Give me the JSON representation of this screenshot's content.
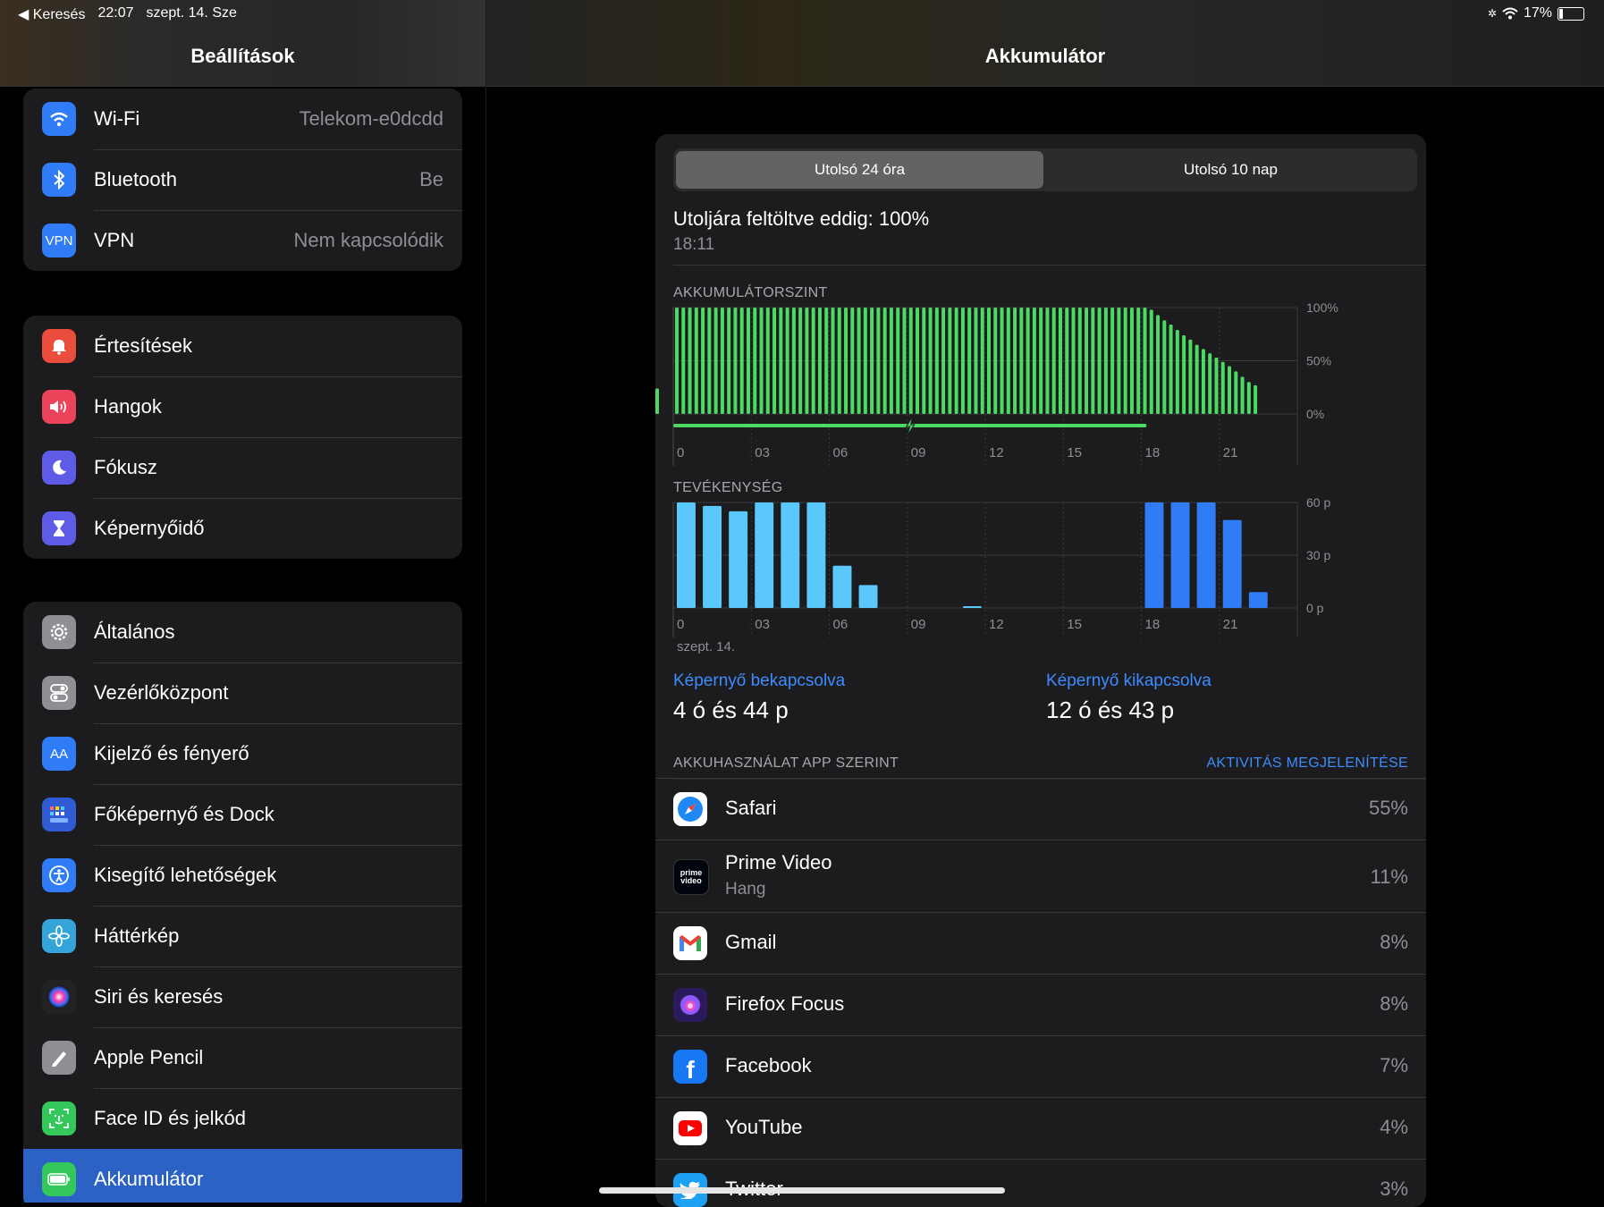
{
  "status_bar": {
    "back_label": "◀ Keresés",
    "time": "22:07",
    "date": "szept. 14. Sze",
    "battery_pct": "17%",
    "battery_level": 0.17
  },
  "sidebar": {
    "title": "Beállítások",
    "group1": [
      {
        "label": "Wi-Fi",
        "value": "Telekom-e0dcdd",
        "icon": "wifi-icon",
        "color": "#2f7cf6"
      },
      {
        "label": "Bluetooth",
        "value": "Be",
        "icon": "bluetooth-icon",
        "color": "#2f7cf6"
      },
      {
        "label": "VPN",
        "value": "Nem kapcsolódik",
        "icon": "vpn-icon",
        "icon_text": "VPN",
        "color": "#2f7cf6"
      }
    ],
    "group2": [
      {
        "label": "Értesítések",
        "icon": "notifications-icon",
        "color": "#eb4d3d"
      },
      {
        "label": "Hangok",
        "icon": "sounds-icon",
        "color": "#eb445a"
      },
      {
        "label": "Fókusz",
        "icon": "focus-moon-icon",
        "color": "#5e5ce6"
      },
      {
        "label": "Képernyőidő",
        "icon": "hourglass-icon",
        "color": "#5e5ce6"
      }
    ],
    "group3": [
      {
        "label": "Általános",
        "icon": "gear-icon",
        "color": "#8e8e93"
      },
      {
        "label": "Vezérlőközpont",
        "icon": "toggles-icon",
        "color": "#8e8e93"
      },
      {
        "label": "Kijelző és fényerő",
        "icon": "display-icon",
        "icon_text": "AA",
        "color": "#2f7cf6"
      },
      {
        "label": "Főképernyő és Dock",
        "icon": "home-screen-icon",
        "color": "#2f5bd3"
      },
      {
        "label": "Kisegítő lehetőségek",
        "icon": "accessibility-icon",
        "color": "#2f7cf6"
      },
      {
        "label": "Háttérkép",
        "icon": "wallpaper-flower-icon",
        "color": "#35a4d9"
      },
      {
        "label": "Siri és keresés",
        "icon": "siri-icon",
        "color": "#222"
      },
      {
        "label": "Apple Pencil",
        "icon": "pencil-icon",
        "color": "#8e8e93"
      },
      {
        "label": "Face ID és jelkód",
        "icon": "face-id-icon",
        "color": "#34c759"
      },
      {
        "label": "Akkumulátor",
        "icon": "battery-icon",
        "color": "#34c759",
        "selected": true
      }
    ]
  },
  "main": {
    "title": "Akkumulátor",
    "tabs": [
      "Utolsó 24 óra",
      "Utolsó 10 nap"
    ],
    "last_charged_label": "Utoljára feltöltve eddig: 100%",
    "last_charged_time": "18:11",
    "battery_chart_label": "AKKUMULÁTORSZINT",
    "activity_chart_label": "TEVÉKENYSÉG",
    "screen_on_label": "Képernyő bekapcsolva",
    "screen_on_value": "4 ó és 44 p",
    "screen_off_label": "Képernyő kikapcsolva",
    "screen_off_value": "12 ó és 43 p",
    "usage_header": "AKKUHASZNÁLAT APP SZERINT",
    "usage_link": "AKTIVITÁS MEGJELENÍTÉSE",
    "apps": [
      {
        "name": "Safari",
        "pct": "55%",
        "icon": "safari-icon"
      },
      {
        "name": "Prime Video",
        "sub": "Hang",
        "pct": "11%",
        "icon": "prime-video-icon",
        "icon_text": "prime video"
      },
      {
        "name": "Gmail",
        "pct": "8%",
        "icon": "gmail-icon",
        "icon_text": "M"
      },
      {
        "name": "Firefox Focus",
        "pct": "8%",
        "icon": "firefox-focus-icon"
      },
      {
        "name": "Facebook",
        "pct": "7%",
        "icon": "facebook-icon",
        "icon_text": "f"
      },
      {
        "name": "YouTube",
        "pct": "4%",
        "icon": "youtube-icon",
        "icon_text": "▶"
      },
      {
        "name": "Twitter",
        "pct": "3%",
        "icon": "twitter-icon"
      }
    ]
  },
  "chart_data": [
    {
      "type": "bar",
      "title": "AKKUMULÁTORSZINT",
      "x_ticks": [
        "0",
        "03",
        "06",
        "09",
        "12",
        "15",
        "18",
        "21"
      ],
      "y_ticks": [
        "100%",
        "50%",
        "0%"
      ],
      "ylim": [
        0,
        100
      ],
      "y_unit": "%",
      "color": "#4cd964",
      "x_hours": [
        0,
        0.25,
        0.5,
        0.75,
        1,
        1.25,
        1.5,
        1.75,
        2,
        2.25,
        2.5,
        2.75,
        3,
        3.25,
        3.5,
        3.75,
        4,
        4.25,
        4.5,
        4.75,
        5,
        5.25,
        5.5,
        5.75,
        6,
        6.25,
        6.5,
        6.75,
        7,
        7.25,
        7.5,
        7.75,
        8,
        8.25,
        8.5,
        8.75,
        9,
        9.25,
        9.5,
        9.75,
        10,
        10.25,
        10.5,
        10.75,
        11,
        11.25,
        11.5,
        11.75,
        12,
        12.25,
        12.5,
        12.75,
        13,
        13.25,
        13.5,
        13.75,
        14,
        14.25,
        14.5,
        14.75,
        15,
        15.25,
        15.5,
        15.75,
        16,
        16.25,
        16.5,
        16.75,
        17,
        17.25,
        17.5,
        17.75,
        18,
        18.25,
        18.5,
        18.75,
        19,
        19.25,
        19.5,
        19.75,
        20,
        20.25,
        20.5,
        20.75,
        21,
        21.25,
        21.5,
        21.75,
        22,
        22.25
      ],
      "values": [
        100,
        100,
        100,
        100,
        100,
        100,
        100,
        100,
        100,
        100,
        100,
        100,
        100,
        100,
        100,
        100,
        100,
        100,
        100,
        100,
        100,
        100,
        100,
        100,
        100,
        100,
        100,
        100,
        100,
        100,
        100,
        100,
        100,
        100,
        100,
        100,
        100,
        100,
        100,
        100,
        100,
        100,
        100,
        100,
        100,
        100,
        100,
        100,
        100,
        100,
        100,
        100,
        100,
        100,
        100,
        100,
        100,
        100,
        100,
        100,
        100,
        100,
        100,
        100,
        100,
        100,
        100,
        100,
        100,
        100,
        100,
        100,
        100,
        98,
        93,
        88,
        84,
        79,
        74,
        70,
        65,
        61,
        57,
        53,
        49,
        45,
        40,
        35,
        30,
        27,
        24,
        20
      ],
      "charging_range_hours": [
        0,
        18.2
      ],
      "charging_icon_hour": 9.1
    },
    {
      "type": "bar",
      "title": "TEVÉKENYSÉG",
      "x_ticks": [
        "0",
        "03",
        "06",
        "09",
        "12",
        "15",
        "18",
        "21"
      ],
      "y_ticks": [
        "60 p",
        "30 p",
        "0 p"
      ],
      "ylim": [
        0,
        60
      ],
      "y_unit": "p",
      "x_caption": "szept. 14.",
      "series": [
        {
          "color": "#5ac8fa",
          "hours": [
            0,
            1,
            2,
            3,
            4,
            5,
            6,
            7,
            11
          ],
          "values": [
            60,
            58,
            55,
            60,
            60,
            60,
            24,
            13,
            1
          ]
        },
        {
          "color": "#2f7cf6",
          "hours": [
            18,
            19,
            20,
            21,
            22
          ],
          "values": [
            60,
            60,
            60,
            50,
            9
          ]
        }
      ]
    }
  ]
}
